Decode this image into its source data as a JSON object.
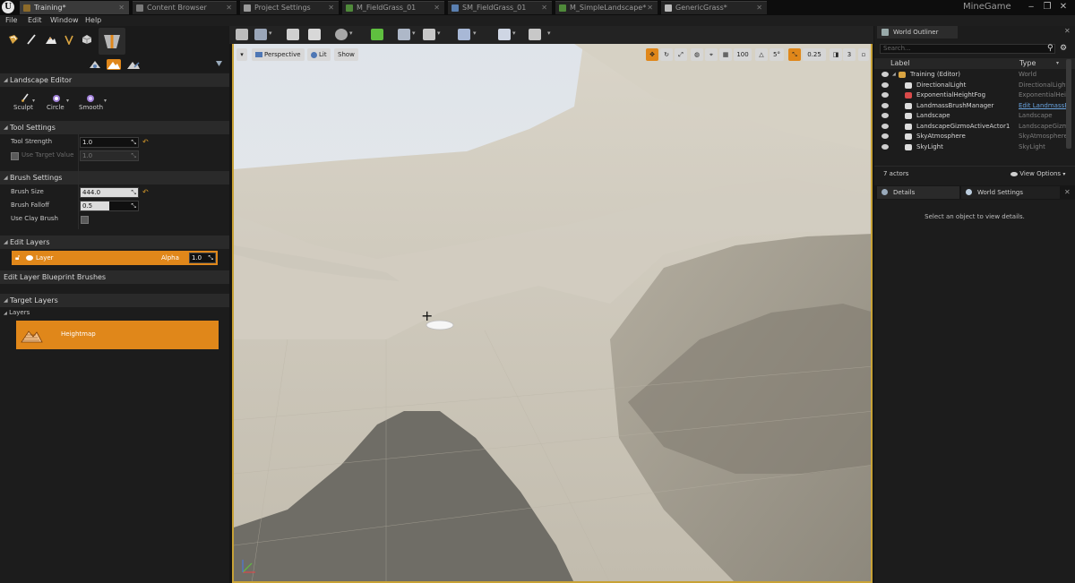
{
  "tabs": [
    {
      "label": "Training*",
      "icon_color": "#8d6b2a",
      "active": true
    },
    {
      "label": "Content Browser",
      "icon_color": "#7a7a7a"
    },
    {
      "label": "Project Settings",
      "icon_color": "#9a9a9a"
    },
    {
      "label": "M_FieldGrass_01",
      "icon_color": "#4f8a3a"
    },
    {
      "label": "SM_FieldGrass_01",
      "icon_color": "#5a7fb0"
    },
    {
      "label": "M_SimpleLandscape*",
      "icon_color": "#4f8a3a"
    },
    {
      "label": "GenericGrass*",
      "icon_color": "#bbbbbb"
    }
  ],
  "project_name": "MineGame",
  "window_controls": [
    "‒",
    "❐",
    "✕"
  ],
  "menu": [
    "File",
    "Edit",
    "Window",
    "Help"
  ],
  "landscape_editor": {
    "title": "Landscape Editor",
    "tools": [
      {
        "label": "Sculpt",
        "icon": "brush-icon"
      },
      {
        "label": "Circle",
        "icon": "circle-brush-icon"
      },
      {
        "label": "Smooth",
        "icon": "smooth-icon"
      }
    ]
  },
  "tool_settings": {
    "title": "Tool Settings",
    "tool_strength_label": "Tool Strength",
    "tool_strength": "1.0",
    "use_target_value_label": "Use Target Value",
    "target_value": "1.0"
  },
  "brush_settings": {
    "title": "Brush Settings",
    "brush_size_label": "Brush Size",
    "brush_size": "444.0",
    "brush_falloff_label": "Brush Falloff",
    "brush_falloff": "0.5",
    "brush_falloff_fraction": 0.5,
    "use_clay_brush_label": "Use Clay Brush"
  },
  "edit_layers": {
    "title": "Edit Layers",
    "layer_name": "Layer",
    "alpha_label": "Alpha",
    "alpha_value": "1.0"
  },
  "edit_layer_blueprint_brushes": {
    "title": "Edit Layer Blueprint Brushes"
  },
  "target_layers": {
    "title": "Target Layers",
    "layers_label": "Layers",
    "heightmap_label": "Heightmap"
  },
  "viewport": {
    "perspective_label": "Perspective",
    "lit_label": "Lit",
    "show_label": "Show",
    "grid_snap_value": "100",
    "rotation_snap_value": "5°",
    "scale_snap_value": "0.25",
    "camera_speed_value": "3",
    "accent_color": "#e0871a",
    "border_color": "#c8a236"
  },
  "world_outliner": {
    "tab_label": "World Outliner",
    "search_placeholder": "Search...",
    "col_label": "Label",
    "col_type": "Type",
    "rows": [
      {
        "label": "Training (Editor)",
        "type": "World",
        "indent": 0,
        "icon_color": "#d9a441"
      },
      {
        "label": "DirectionalLight",
        "type": "DirectionalLight",
        "indent": 1,
        "icon_color": "#dddddd"
      },
      {
        "label": "ExponentialHeightFog",
        "type": "ExponentialHeightFog",
        "indent": 1,
        "icon_color": "#d94a4a"
      },
      {
        "label": "LandmassBrushManager",
        "type": "Edit LandmassB",
        "indent": 1,
        "icon_color": "#dddddd",
        "type_is_link": true
      },
      {
        "label": "Landscape",
        "type": "Landscape",
        "indent": 1,
        "icon_color": "#dddddd"
      },
      {
        "label": "LandscapeGizmoActiveActor1",
        "type": "LandscapeGizmo",
        "indent": 1,
        "icon_color": "#dddddd"
      },
      {
        "label": "SkyAtmosphere",
        "type": "SkyAtmosphere",
        "indent": 1,
        "icon_color": "#dddddd"
      },
      {
        "label": "SkyLight",
        "type": "SkyLight",
        "indent": 1,
        "icon_color": "#dddddd"
      }
    ],
    "actor_count": "7 actors",
    "view_options_label": "View Options"
  },
  "details": {
    "tab_label": "Details",
    "world_settings_tab_label": "World Settings",
    "empty_message": "Select an object to view details."
  }
}
